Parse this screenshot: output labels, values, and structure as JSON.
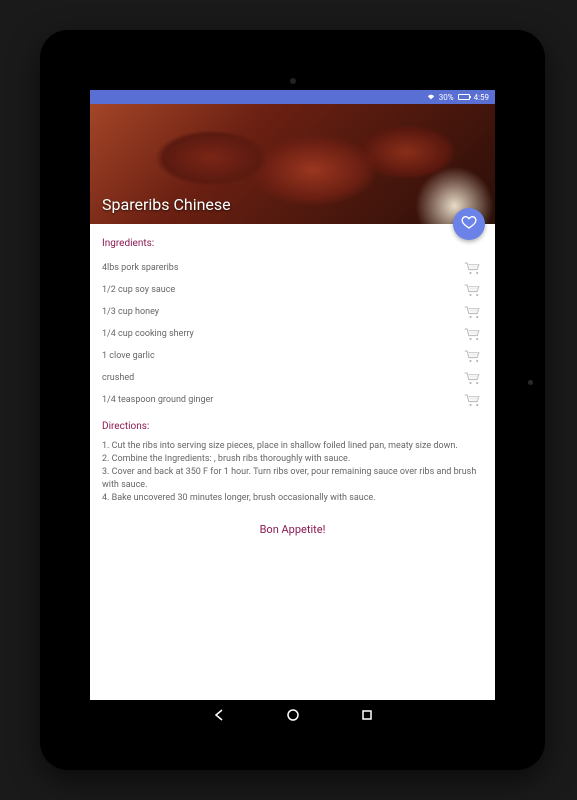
{
  "status": {
    "battery_pct": "30%",
    "time": "4:59"
  },
  "hero": {
    "title": "Spareribs Chinese"
  },
  "ingredients": {
    "heading": "Ingredients:",
    "items": [
      "4lbs pork spareribs",
      "1/2 cup soy sauce",
      "1/3 cup honey",
      "1/4 cup cooking sherry",
      "1 clove garlic",
      "crushed",
      "1/4 teaspoon ground ginger"
    ]
  },
  "directions": {
    "heading": "Directions:",
    "text": "1. Cut the ribs into serving size pieces, place in shallow foiled lined pan, meaty size down.\n2. Combine the Ingredients: , brush ribs thoroughly with sauce.\n3. Cover and back at 350 F for 1 hour. Turn ribs over, pour remaining sauce over ribs and brush with sauce.\n4. Bake uncovered 30 minutes longer, brush occasionally with sauce."
  },
  "footer_message": "Bon Appetite!"
}
